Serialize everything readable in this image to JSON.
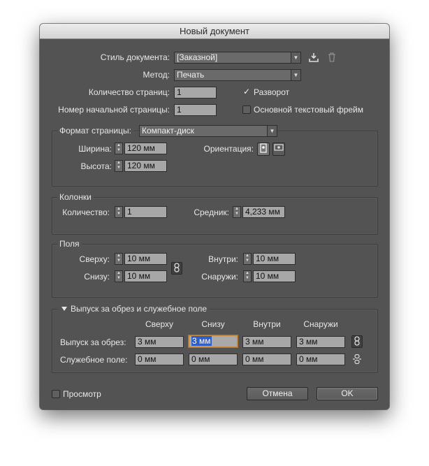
{
  "dialog": {
    "title": "Новый документ"
  },
  "document": {
    "style_label": "Стиль документа:",
    "style_value": "[Заказной]",
    "intent_label": "Метод:",
    "intent_value": "Печать",
    "pages_label": "Количество страниц:",
    "pages_value": "1",
    "start_page_label": "Номер начальной страницы:",
    "start_page_value": "1",
    "facing_pages_label": "Разворот",
    "facing_pages_checked": true,
    "primary_text_frame_label": "Основной текстовый фрейм",
    "primary_text_frame_checked": false,
    "icons": {
      "save_preset": "save-preset-icon",
      "delete_preset": "trash-icon"
    }
  },
  "page_size": {
    "label": "Формат страницы:",
    "value": "Компакт-диск",
    "width_label": "Ширина:",
    "width_value": "120 мм",
    "height_label": "Высота:",
    "height_value": "120 мм",
    "orientation_label": "Ориентация:",
    "orientation_selected": "portrait"
  },
  "columns": {
    "title": "Колонки",
    "number_label": "Количество:",
    "number_value": "1",
    "gutter_label": "Средник:",
    "gutter_value": "4,233 мм"
  },
  "margins": {
    "title": "Поля",
    "top_label": "Сверху:",
    "top_value": "10 мм",
    "bottom_label": "Снизу:",
    "bottom_value": "10 мм",
    "inside_label": "Внутри:",
    "inside_value": "10 мм",
    "outside_label": "Снаружи:",
    "outside_value": "10 мм",
    "linked": true
  },
  "bleed_slug": {
    "title": "Выпуск за обрез и служебное поле",
    "expanded": true,
    "col_headers": [
      "Сверху",
      "Снизу",
      "Внутри",
      "Снаружи"
    ],
    "bleed_label": "Выпуск за обрез:",
    "bleed_values": [
      "3 мм",
      "3 мм",
      "3 мм",
      "3 мм"
    ],
    "bleed_linked": true,
    "slug_label": "Служебное поле:",
    "slug_values": [
      "0 мм",
      "0 мм",
      "0 мм",
      "0 мм"
    ],
    "slug_linked": false
  },
  "footer": {
    "preview_label": "Просмотр",
    "preview_checked": false,
    "cancel_label": "Отмена",
    "ok_label": "OK"
  },
  "colors": {
    "dialog_bg": "#535353",
    "field_bg": "#a7a7a7",
    "focus_ring": "#c98a3a",
    "selection": "#2f5fc4"
  }
}
